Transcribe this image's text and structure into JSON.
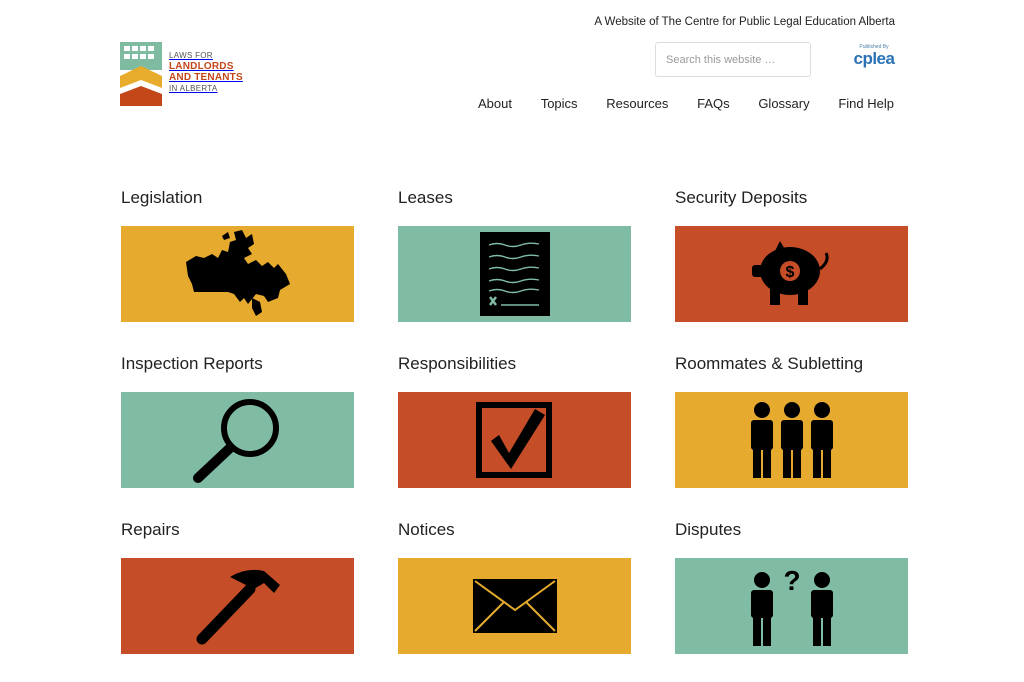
{
  "header": {
    "tagline": "A Website of The Centre for Public Legal Education Alberta",
    "logo": {
      "line1": "LAWS FOR",
      "line2": "LANDLORDS",
      "line3": "AND TENANTS",
      "line4": "IN ALBERTA"
    },
    "search": {
      "placeholder": "Search this website …",
      "value": ""
    },
    "publisher": {
      "small": "Published By",
      "mark": "cplea"
    },
    "nav": [
      "About",
      "Topics",
      "Resources",
      "FAQs",
      "Glossary",
      "Find Help"
    ]
  },
  "topics": [
    {
      "title": "Legislation",
      "color": "#e6ab2e",
      "icon": "canada-map-icon"
    },
    {
      "title": "Leases",
      "color": "#80bca3",
      "icon": "document-icon"
    },
    {
      "title": "Security Deposits",
      "color": "#c54d27",
      "icon": "piggy-bank-icon"
    },
    {
      "title": "Inspection Reports",
      "color": "#80bca3",
      "icon": "magnifying-glass-icon"
    },
    {
      "title": "Responsibilities",
      "color": "#c54d27",
      "icon": "checkbox-icon"
    },
    {
      "title": "Roommates & Subletting",
      "color": "#e6ab2e",
      "icon": "three-people-icon"
    },
    {
      "title": "Repairs",
      "color": "#c54d27",
      "icon": "hammer-icon"
    },
    {
      "title": "Notices",
      "color": "#e6ab2e",
      "icon": "envelope-icon"
    },
    {
      "title": "Disputes",
      "color": "#80bca3",
      "icon": "two-people-question-icon"
    }
  ],
  "colors": {
    "gold": "#e6ab2e",
    "teal": "#80bca3",
    "rust": "#c54d27"
  }
}
